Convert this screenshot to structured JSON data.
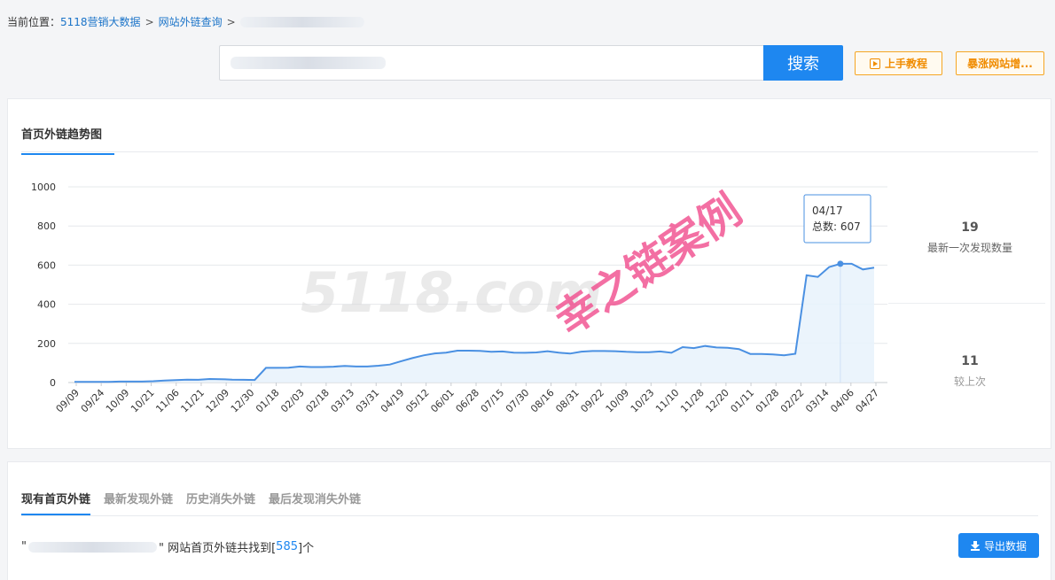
{
  "breadcrumb": {
    "prefix": "当前位置：",
    "items": [
      "5118营销大数据",
      "网站外链查询"
    ],
    "separator": ">"
  },
  "search": {
    "button_label": "搜索"
  },
  "actions": {
    "tutorial_label": "上手教程",
    "site_label": "暴涨网站增..."
  },
  "chart_card": {
    "tab_label": "首页外链趋势图",
    "latest_count": "19",
    "latest_label": "最新一次发现数量",
    "delta_count": "11",
    "delta_label": "较上次",
    "tooltip": {
      "date": "04/17",
      "label": "总数:",
      "value": "607"
    },
    "watermark_brand": "5118.com",
    "watermark_stamp": "幸之链案例"
  },
  "chart_data": {
    "type": "area",
    "title": "",
    "xlabel": "",
    "ylabel": "",
    "ylim": [
      0,
      1000
    ],
    "yticks": [
      0,
      200,
      400,
      600,
      800,
      1000
    ],
    "grid": true,
    "tick_labels": [
      "09/09",
      "09/24",
      "10/09",
      "10/21",
      "11/06",
      "11/21",
      "12/09",
      "12/30",
      "01/18",
      "02/03",
      "02/18",
      "03/13",
      "03/31",
      "04/19",
      "05/12",
      "06/01",
      "06/28",
      "07/15",
      "07/30",
      "08/16",
      "08/31",
      "09/22",
      "10/09",
      "10/23",
      "11/10",
      "11/28",
      "12/20",
      "01/11",
      "01/28",
      "02/22",
      "03/14",
      "04/06",
      "04/27"
    ],
    "values": [
      3,
      3,
      3,
      3,
      5,
      5,
      5,
      7,
      10,
      12,
      15,
      14,
      18,
      17,
      15,
      14,
      13,
      75,
      75,
      76,
      82,
      79,
      79,
      81,
      85,
      82,
      82,
      86,
      92,
      109,
      125,
      139,
      149,
      153,
      163,
      163,
      162,
      157,
      159,
      153,
      152,
      154,
      160,
      153,
      148,
      158,
      161,
      161,
      160,
      157,
      155,
      155,
      159,
      152,
      181,
      176,
      187,
      179,
      178,
      171,
      146,
      146,
      144,
      139,
      147,
      548,
      540,
      590,
      607,
      607,
      578,
      587
    ]
  },
  "list_card": {
    "tabs": [
      "现有首页外链",
      "最新发现外链",
      "历史消失外链",
      "最后发现消失外链"
    ],
    "result_open_quote": "\"",
    "result_text": "\" 网站首页外链共找到[",
    "result_count": "585",
    "result_suffix": "]个",
    "export_label": "导出数据"
  }
}
